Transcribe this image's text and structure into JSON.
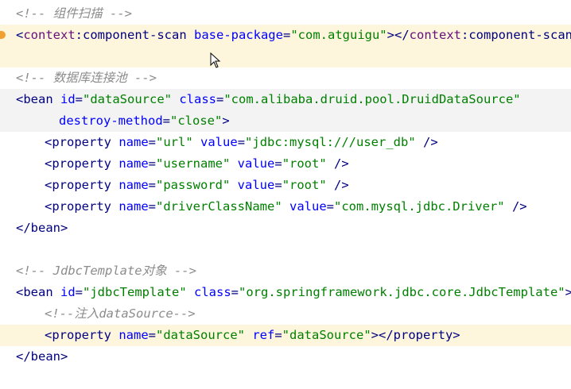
{
  "lines": [
    {
      "comment": "<!-- 组件扫描 -->"
    },
    {
      "tag_open": "<",
      "ns": "context",
      "name": ":component-scan",
      "attr": " base-package",
      "eq": "=",
      "val": "\"com.atguigu\"",
      "close": ">",
      "end_open": "</",
      "end_ns": "context",
      "end_name": ":component-scan"
    },
    {
      "blank": ""
    },
    {
      "comment": "<!-- 数据库连接池 -->"
    },
    {
      "tag": "<bean",
      "a1": " id",
      "v1": "\"dataSource\"",
      "a2": " class",
      "v2": "\"com.alibaba.druid.pool.DruidDataSource\""
    },
    {
      "a1": "destroy-method",
      "v1": "\"close\"",
      "close": ">"
    },
    {
      "tag": "<property",
      "a1": " name",
      "v1": "\"url\"",
      "a2": " value",
      "v2": "\"jdbc:mysql:///user_db\"",
      "close": " />"
    },
    {
      "tag": "<property",
      "a1": " name",
      "v1": "\"username\"",
      "a2": " value",
      "v2": "\"root\"",
      "close": " />"
    },
    {
      "tag": "<property",
      "a1": " name",
      "v1": "\"password\"",
      "a2": " value",
      "v2": "\"root\"",
      "close": " />"
    },
    {
      "tag": "<property",
      "a1": " name",
      "v1": "\"driverClassName\"",
      "a2": " value",
      "v2": "\"com.mysql.jdbc.Driver\"",
      "close": " />"
    },
    {
      "tag": "</bean>"
    },
    {
      "blank": ""
    },
    {
      "comment": "<!-- JdbcTemplate对象 -->"
    },
    {
      "tag": "<bean",
      "a1": " id",
      "v1": "\"jdbcTemplate\"",
      "a2": " class",
      "v2": "\"org.springframework.jdbc.core.JdbcTemplate\"",
      "close": ">"
    },
    {
      "comment": "<!--注入dataSource-->"
    },
    {
      "tag": "<property",
      "a1": " name",
      "v1": "\"dataSource\"",
      "a2": " ref",
      "v2": "\"dataSource\"",
      "close": "></property>"
    },
    {
      "tag": "</bean>"
    }
  ]
}
